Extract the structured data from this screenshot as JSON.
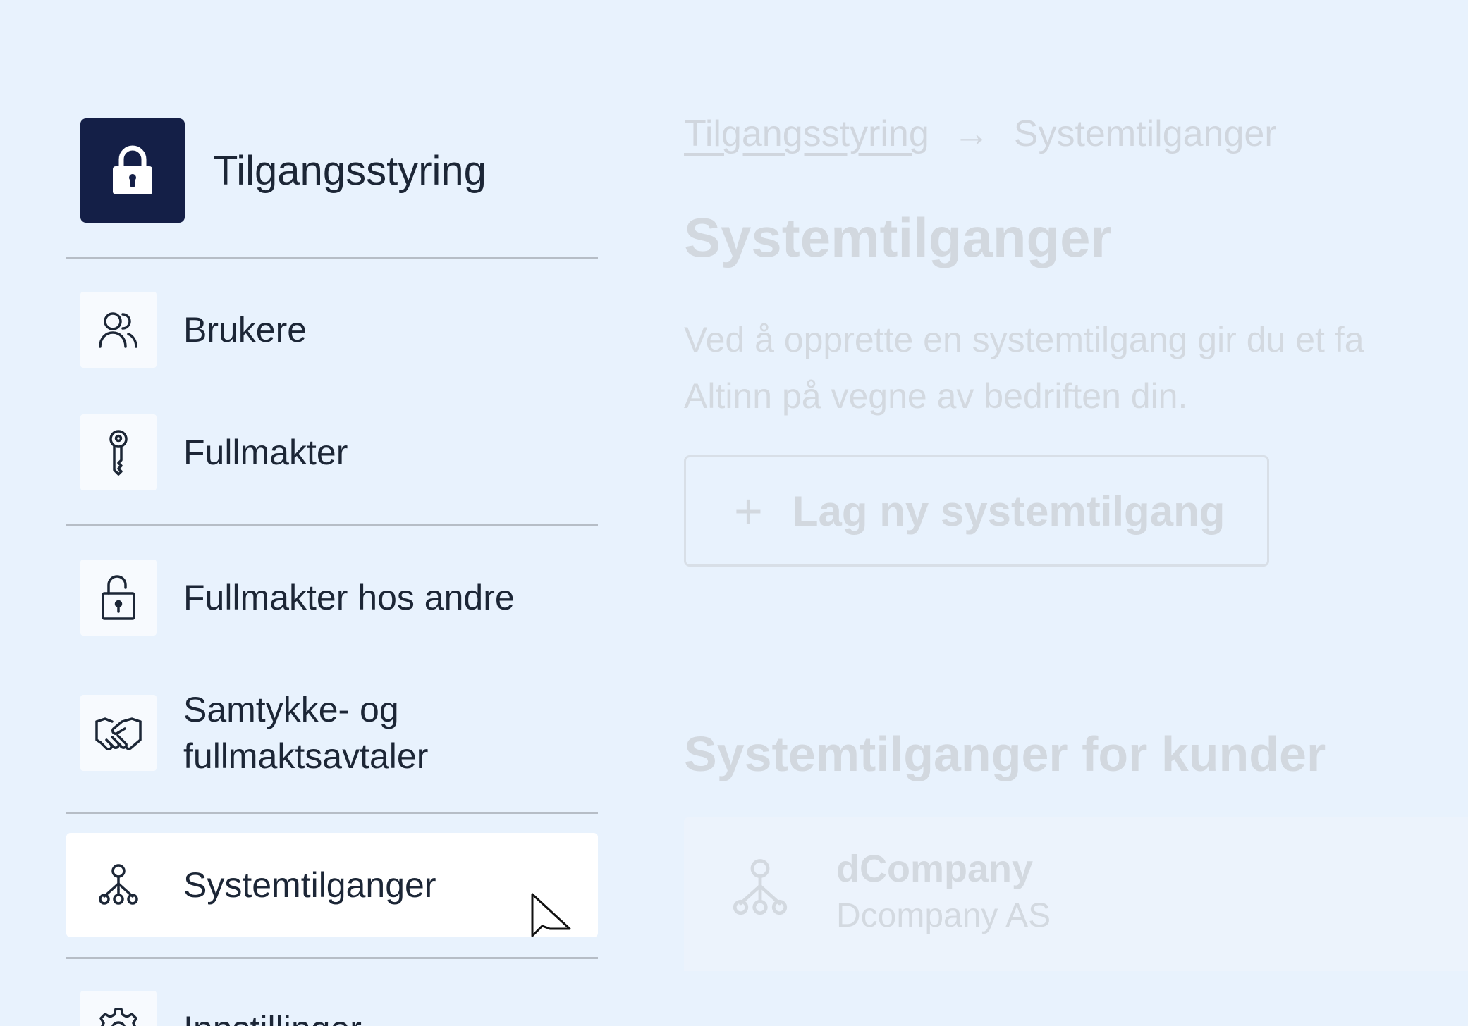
{
  "sidebar": {
    "header": {
      "title": "Tilgangsstyring",
      "icon": "lock-icon"
    },
    "items": [
      {
        "label": "Brukere",
        "icon": "users-icon"
      },
      {
        "label": "Fullmakter",
        "icon": "key-icon"
      },
      {
        "label": "Fullmakter hos andre",
        "icon": "padlock-open-icon"
      },
      {
        "label_line1": "Samtykke- og",
        "label_line2": "fullmaktsavtaler",
        "icon": "handshake-icon"
      },
      {
        "label": "Systemtilganger",
        "icon": "system-access-icon",
        "active": true
      },
      {
        "label": "Innstillinger",
        "icon": "gear-icon"
      }
    ]
  },
  "main": {
    "breadcrumb": {
      "link": "Tilgangsstyring",
      "separator": "→",
      "current": "Systemtilganger"
    },
    "title": "Systemtilganger",
    "description_line1": "Ved å opprette en systemtilgang gir du et fa",
    "description_line2": "Altinn på vegne av bedriften din.",
    "add_button": {
      "icon": "plus",
      "label": "Lag ny systemtilgang"
    },
    "customers_section": {
      "title": "Systemtilganger for kunder",
      "items": [
        {
          "name": "dCompany",
          "org": "Dcompany AS",
          "icon": "system-access-icon"
        }
      ]
    }
  },
  "colors": {
    "background": "#e8f2fd",
    "header_icon_bg": "#141f47",
    "text": "#1c2636",
    "faded_text": "#d2d8df",
    "divider": "#b6bdc6",
    "active_item_bg": "#ffffff"
  }
}
